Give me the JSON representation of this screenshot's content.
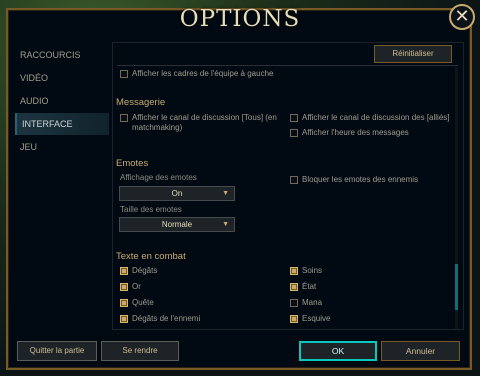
{
  "title": "OPTIONS",
  "close_glyph": "✕",
  "sidebar": {
    "items": [
      {
        "label": "RACCOURCIS"
      },
      {
        "label": "VIDÉO"
      },
      {
        "label": "AUDIO"
      },
      {
        "label": "INTERFACE"
      },
      {
        "label": "JEU"
      }
    ],
    "active": "INTERFACE"
  },
  "toolbar": {
    "reset_label": "Réinitialiser"
  },
  "interface": {
    "team_frames": {
      "label": "Afficher les cadres de l'équipe à gauche",
      "checked": false
    },
    "messagerie": {
      "title": "Messagerie",
      "all_chat": {
        "label": "Afficher le canal de discussion [Tous] (en matchmaking)",
        "checked": false
      },
      "allies_chat": {
        "label": "Afficher le canal de discussion des [alliés]",
        "checked": false
      },
      "timestamps": {
        "label": "Afficher l'heure des messages",
        "checked": false
      }
    },
    "emotes": {
      "title": "Emotes",
      "display_label": "Affichage des emotes",
      "display_value": "On",
      "size_label": "Taille des emotes",
      "size_value": "Normale",
      "block_enemy": {
        "label": "Bloquer les emotes des ennemis",
        "checked": false
      }
    },
    "combat_text": {
      "title": "Texte en combat",
      "left": [
        {
          "label": "Dégâts",
          "checked": true
        },
        {
          "label": "Or",
          "checked": true
        },
        {
          "label": "Quête",
          "checked": true
        },
        {
          "label": "Dégâts de l'ennemi",
          "checked": true
        }
      ],
      "right": [
        {
          "label": "Soins",
          "checked": true
        },
        {
          "label": "État",
          "checked": true
        },
        {
          "label": "Mana",
          "checked": false
        },
        {
          "label": "Esquive",
          "checked": true
        }
      ]
    }
  },
  "footer": {
    "quit_label": "Quitter la partie",
    "surrender_label": "Se rendre",
    "ok_label": "OK",
    "cancel_label": "Annuler"
  },
  "colors": {
    "gold": "#c8aa6e",
    "teal": "#0ac8b9",
    "frame_bg": "#010a13"
  }
}
